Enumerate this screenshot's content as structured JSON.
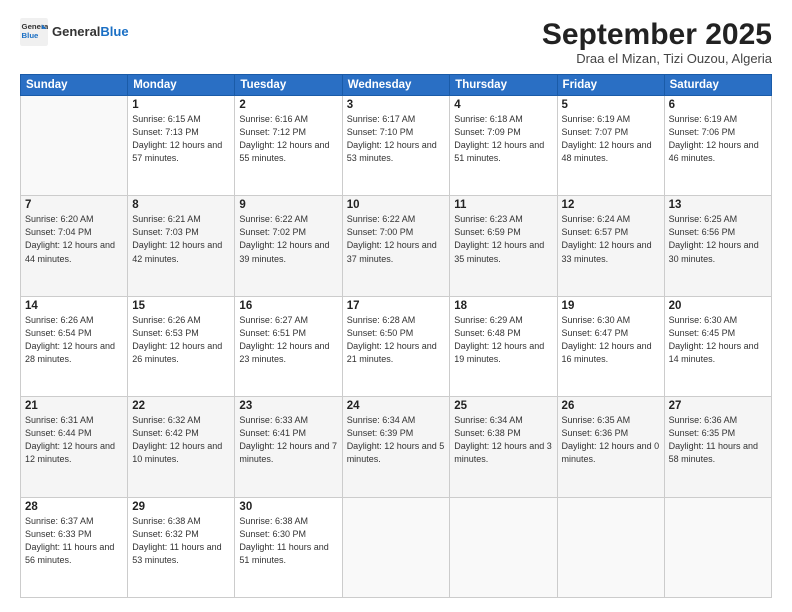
{
  "logo": {
    "line1": "General",
    "line2": "Blue"
  },
  "title": "September 2025",
  "location": "Draa el Mizan, Tizi Ouzou, Algeria",
  "weekdays": [
    "Sunday",
    "Monday",
    "Tuesday",
    "Wednesday",
    "Thursday",
    "Friday",
    "Saturday"
  ],
  "weeks": [
    [
      {
        "day": "",
        "content": ""
      },
      {
        "day": "1",
        "content": "Sunrise: 6:15 AM\nSunset: 7:13 PM\nDaylight: 12 hours\nand 57 minutes."
      },
      {
        "day": "2",
        "content": "Sunrise: 6:16 AM\nSunset: 7:12 PM\nDaylight: 12 hours\nand 55 minutes."
      },
      {
        "day": "3",
        "content": "Sunrise: 6:17 AM\nSunset: 7:10 PM\nDaylight: 12 hours\nand 53 minutes."
      },
      {
        "day": "4",
        "content": "Sunrise: 6:18 AM\nSunset: 7:09 PM\nDaylight: 12 hours\nand 51 minutes."
      },
      {
        "day": "5",
        "content": "Sunrise: 6:19 AM\nSunset: 7:07 PM\nDaylight: 12 hours\nand 48 minutes."
      },
      {
        "day": "6",
        "content": "Sunrise: 6:19 AM\nSunset: 7:06 PM\nDaylight: 12 hours\nand 46 minutes."
      }
    ],
    [
      {
        "day": "7",
        "content": "Sunrise: 6:20 AM\nSunset: 7:04 PM\nDaylight: 12 hours\nand 44 minutes."
      },
      {
        "day": "8",
        "content": "Sunrise: 6:21 AM\nSunset: 7:03 PM\nDaylight: 12 hours\nand 42 minutes."
      },
      {
        "day": "9",
        "content": "Sunrise: 6:22 AM\nSunset: 7:02 PM\nDaylight: 12 hours\nand 39 minutes."
      },
      {
        "day": "10",
        "content": "Sunrise: 6:22 AM\nSunset: 7:00 PM\nDaylight: 12 hours\nand 37 minutes."
      },
      {
        "day": "11",
        "content": "Sunrise: 6:23 AM\nSunset: 6:59 PM\nDaylight: 12 hours\nand 35 minutes."
      },
      {
        "day": "12",
        "content": "Sunrise: 6:24 AM\nSunset: 6:57 PM\nDaylight: 12 hours\nand 33 minutes."
      },
      {
        "day": "13",
        "content": "Sunrise: 6:25 AM\nSunset: 6:56 PM\nDaylight: 12 hours\nand 30 minutes."
      }
    ],
    [
      {
        "day": "14",
        "content": "Sunrise: 6:26 AM\nSunset: 6:54 PM\nDaylight: 12 hours\nand 28 minutes."
      },
      {
        "day": "15",
        "content": "Sunrise: 6:26 AM\nSunset: 6:53 PM\nDaylight: 12 hours\nand 26 minutes."
      },
      {
        "day": "16",
        "content": "Sunrise: 6:27 AM\nSunset: 6:51 PM\nDaylight: 12 hours\nand 23 minutes."
      },
      {
        "day": "17",
        "content": "Sunrise: 6:28 AM\nSunset: 6:50 PM\nDaylight: 12 hours\nand 21 minutes."
      },
      {
        "day": "18",
        "content": "Sunrise: 6:29 AM\nSunset: 6:48 PM\nDaylight: 12 hours\nand 19 minutes."
      },
      {
        "day": "19",
        "content": "Sunrise: 6:30 AM\nSunset: 6:47 PM\nDaylight: 12 hours\nand 16 minutes."
      },
      {
        "day": "20",
        "content": "Sunrise: 6:30 AM\nSunset: 6:45 PM\nDaylight: 12 hours\nand 14 minutes."
      }
    ],
    [
      {
        "day": "21",
        "content": "Sunrise: 6:31 AM\nSunset: 6:44 PM\nDaylight: 12 hours\nand 12 minutes."
      },
      {
        "day": "22",
        "content": "Sunrise: 6:32 AM\nSunset: 6:42 PM\nDaylight: 12 hours\nand 10 minutes."
      },
      {
        "day": "23",
        "content": "Sunrise: 6:33 AM\nSunset: 6:41 PM\nDaylight: 12 hours\nand 7 minutes."
      },
      {
        "day": "24",
        "content": "Sunrise: 6:34 AM\nSunset: 6:39 PM\nDaylight: 12 hours\nand 5 minutes."
      },
      {
        "day": "25",
        "content": "Sunrise: 6:34 AM\nSunset: 6:38 PM\nDaylight: 12 hours\nand 3 minutes."
      },
      {
        "day": "26",
        "content": "Sunrise: 6:35 AM\nSunset: 6:36 PM\nDaylight: 12 hours\nand 0 minutes."
      },
      {
        "day": "27",
        "content": "Sunrise: 6:36 AM\nSunset: 6:35 PM\nDaylight: 11 hours\nand 58 minutes."
      }
    ],
    [
      {
        "day": "28",
        "content": "Sunrise: 6:37 AM\nSunset: 6:33 PM\nDaylight: 11 hours\nand 56 minutes."
      },
      {
        "day": "29",
        "content": "Sunrise: 6:38 AM\nSunset: 6:32 PM\nDaylight: 11 hours\nand 53 minutes."
      },
      {
        "day": "30",
        "content": "Sunrise: 6:38 AM\nSunset: 6:30 PM\nDaylight: 11 hours\nand 51 minutes."
      },
      {
        "day": "",
        "content": ""
      },
      {
        "day": "",
        "content": ""
      },
      {
        "day": "",
        "content": ""
      },
      {
        "day": "",
        "content": ""
      }
    ]
  ]
}
